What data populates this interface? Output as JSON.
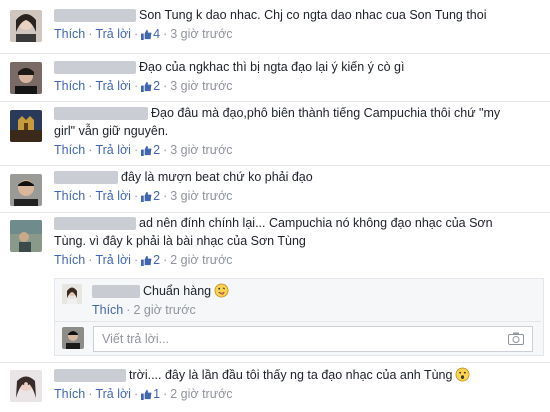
{
  "labels": {
    "like": "Thích",
    "reply": "Trả lời",
    "reply_placeholder": "Viết trả lời..."
  },
  "comments": [
    {
      "text": "Son Tung k dao nhac. Chj co ngta dao nhac cua Son Tung thoi",
      "likes": "4",
      "time": "3 giờ trước"
    },
    {
      "text": "Đạo của ngkhac thì bị ngta đạo lại ý kiến ý cò gì",
      "likes": "2",
      "time": "3 giờ trước"
    },
    {
      "text": "Đạo đâu mà đạo,phô biên thành tiếng Campuchia thôi chứ \"my girl\" vẫn giữ nguyên.",
      "likes": "2",
      "time": "3 giờ trước"
    },
    {
      "text": "đây là mượn beat chứ ko phải đạo",
      "likes": "2",
      "time": "3 giờ trước"
    },
    {
      "text": "ad nên đính chính lại... Campuchia nó không đạo nhạc của Sơn Tùng. vì đây k phải là bài nhạc của Sơn Tùng",
      "likes": "2",
      "time": "2 giờ trước"
    },
    {
      "text": "trời.... đây là lần đầu tôi thấy ng ta đạo nhạc của anh Tùng",
      "likes": "1",
      "time": "2 giờ trước"
    }
  ],
  "reply": {
    "text": "Chuẩn hàng",
    "time": "2 giờ trước"
  },
  "colors": {
    "link": "#4267b2",
    "meta": "#90949c",
    "text": "#1d2129"
  }
}
